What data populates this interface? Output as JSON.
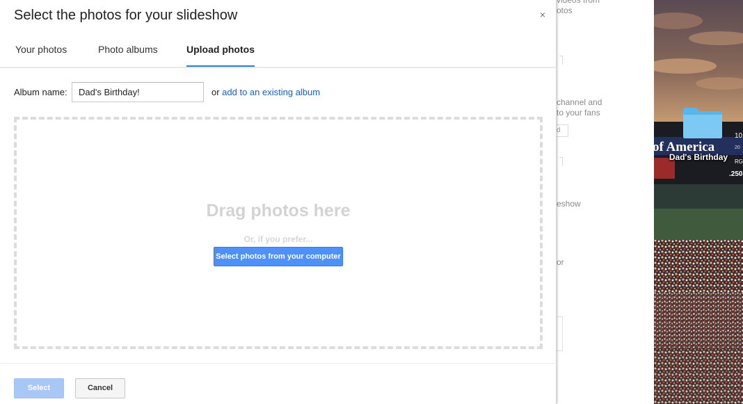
{
  "dialog": {
    "title": "Select the photos for your slideshow",
    "close_glyph": "×",
    "tabs": [
      {
        "label": "Your photos",
        "active": false
      },
      {
        "label": "Photo albums",
        "active": false
      },
      {
        "label": "Upload photos",
        "active": true
      }
    ],
    "album": {
      "label": "Album name:",
      "value": "Dad's Birthday!",
      "or_text": "or ",
      "existing_link": "add to an existing album"
    },
    "dropzone": {
      "title": "Drag photos here",
      "or_text": "Or, if you prefer...",
      "button_label": "Select photos from your computer"
    },
    "footer": {
      "select_label": "Select",
      "cancel_label": "Cancel"
    },
    "colors": {
      "accent": "#4d90fe",
      "link": "#1a5fc4",
      "disabled_button": "#a8c7f7"
    }
  },
  "background_page": {
    "fragments": [
      "videos from",
      "otos",
      "channel and",
      "to your fans",
      "d",
      "eshow",
      "or"
    ]
  },
  "desktop": {
    "folder_icon": "folder-icon",
    "folder_label": "Dad's Birthday",
    "photo_text": {
      "banner": "of America",
      "score_lines": [
        "10",
        "20",
        "RG",
        ".250"
      ]
    }
  }
}
